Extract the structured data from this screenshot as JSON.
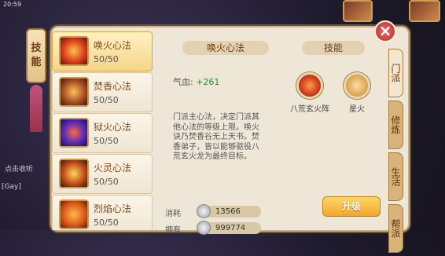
{
  "status": {
    "time": "20:59"
  },
  "hang_tag": {
    "chars": [
      "技",
      "能"
    ]
  },
  "close_symbol": "×",
  "list": {
    "items": [
      {
        "name": "唤火心法",
        "level": "50/50",
        "selected": true,
        "icon": "fire-icon"
      },
      {
        "name": "焚香心法",
        "level": "50/50",
        "selected": false,
        "icon": "censer-icon"
      },
      {
        "name": "狱火心法",
        "level": "50/50",
        "selected": false,
        "icon": "wave-icon"
      },
      {
        "name": "火灵心法",
        "level": "50/50",
        "selected": false,
        "icon": "spirit-icon"
      },
      {
        "name": "烈焰心法",
        "level": "50/50",
        "selected": false,
        "icon": "flame-icon"
      }
    ]
  },
  "detail": {
    "title": "唤火心法",
    "skills_title": "技能",
    "hp_label": "气血:",
    "hp_value": "+261",
    "description": "门派主心法，决定门派其他心法的等级上限。唤火诀乃焚香谷无上天书。焚香弟子，皆以能够驱役八荒玄火龙为最终目标。",
    "skills": [
      {
        "label": "八荒玄火阵",
        "icon": "fire-swirl-icon"
      },
      {
        "label": "星火",
        "icon": "lock-icon"
      }
    ],
    "cost_label": "消耗",
    "cost_value": "13566",
    "owned_label": "拥有",
    "owned_value": "999774",
    "upgrade_label": "升级"
  },
  "tabs": [
    "门派",
    "修炼",
    "生活",
    "帮派"
  ],
  "chat": {
    "line1": "[Gay]",
    "line2": "点击收听"
  }
}
